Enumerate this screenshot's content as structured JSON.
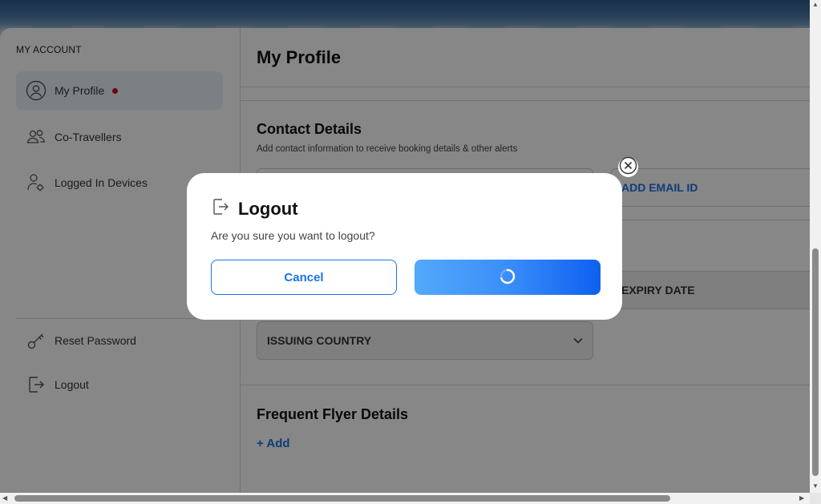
{
  "sidebar": {
    "heading": "MY ACCOUNT",
    "items": [
      {
        "label": "My Profile",
        "icon": "user-circle-icon",
        "active": true,
        "notification": true
      },
      {
        "label": "Co-Travellers",
        "icon": "users-icon"
      },
      {
        "label": "Logged In Devices",
        "icon": "user-gear-icon"
      }
    ],
    "bottom_items": [
      {
        "label": "Reset Password",
        "icon": "key-icon"
      },
      {
        "label": "Logout",
        "icon": "logout-icon"
      }
    ]
  },
  "main": {
    "title": "My Profile",
    "contact": {
      "title": "Contact Details",
      "subtitle": "Add contact information to receive booking details & other alerts",
      "add_email_label": "ADD EMAIL ID"
    },
    "documents": {
      "expiry_label": "EXPIRY DATE",
      "issuing_country_label": "ISSUING COUNTRY"
    },
    "frequent_flyer": {
      "title": "Frequent Flyer Details",
      "add_label": "+ Add"
    }
  },
  "modal": {
    "title": "Logout",
    "message": "Are you sure you want to logout?",
    "cancel_label": "Cancel",
    "confirm_state": "loading"
  },
  "colors": {
    "accent": "#1a73e8",
    "notification": "#d0021b",
    "overlay": "rgba(0,0,0,0.47)"
  }
}
